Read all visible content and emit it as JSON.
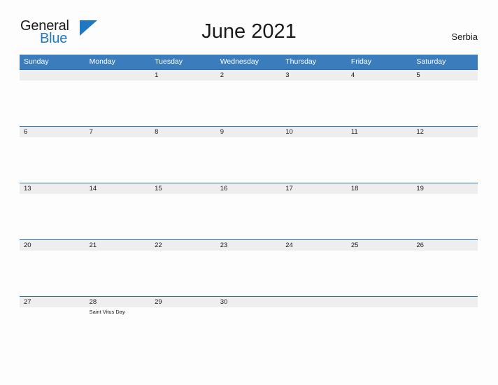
{
  "brand": {
    "name_part1": "General",
    "name_part2": "Blue",
    "triangle_color": "#1f78c1",
    "text_color": "#1a1a1a"
  },
  "header": {
    "title": "June 2021",
    "region": "Serbia"
  },
  "colors": {
    "header_band": "#3b7cbd",
    "day_band": "#eeeeee",
    "day_band_border": "#2f6fad",
    "page_background": "#fdfdfd",
    "text": "#1a1a1a",
    "header_text": "#ffffff"
  },
  "calendar": {
    "month": "June",
    "year": "2021",
    "weekday_headers": [
      "Sunday",
      "Monday",
      "Tuesday",
      "Wednesday",
      "Thursday",
      "Friday",
      "Saturday"
    ],
    "weeks": [
      [
        {
          "day": "",
          "events": []
        },
        {
          "day": "",
          "events": []
        },
        {
          "day": "1",
          "events": []
        },
        {
          "day": "2",
          "events": []
        },
        {
          "day": "3",
          "events": []
        },
        {
          "day": "4",
          "events": []
        },
        {
          "day": "5",
          "events": []
        }
      ],
      [
        {
          "day": "6",
          "events": []
        },
        {
          "day": "7",
          "events": []
        },
        {
          "day": "8",
          "events": []
        },
        {
          "day": "9",
          "events": []
        },
        {
          "day": "10",
          "events": []
        },
        {
          "day": "11",
          "events": []
        },
        {
          "day": "12",
          "events": []
        }
      ],
      [
        {
          "day": "13",
          "events": []
        },
        {
          "day": "14",
          "events": []
        },
        {
          "day": "15",
          "events": []
        },
        {
          "day": "16",
          "events": []
        },
        {
          "day": "17",
          "events": []
        },
        {
          "day": "18",
          "events": []
        },
        {
          "day": "19",
          "events": []
        }
      ],
      [
        {
          "day": "20",
          "events": []
        },
        {
          "day": "21",
          "events": []
        },
        {
          "day": "22",
          "events": []
        },
        {
          "day": "23",
          "events": []
        },
        {
          "day": "24",
          "events": []
        },
        {
          "day": "25",
          "events": []
        },
        {
          "day": "26",
          "events": []
        }
      ],
      [
        {
          "day": "27",
          "events": []
        },
        {
          "day": "28",
          "events": [
            "Saint Vitus Day"
          ]
        },
        {
          "day": "29",
          "events": []
        },
        {
          "day": "30",
          "events": []
        },
        {
          "day": "",
          "events": []
        },
        {
          "day": "",
          "events": []
        },
        {
          "day": "",
          "events": []
        }
      ]
    ]
  }
}
